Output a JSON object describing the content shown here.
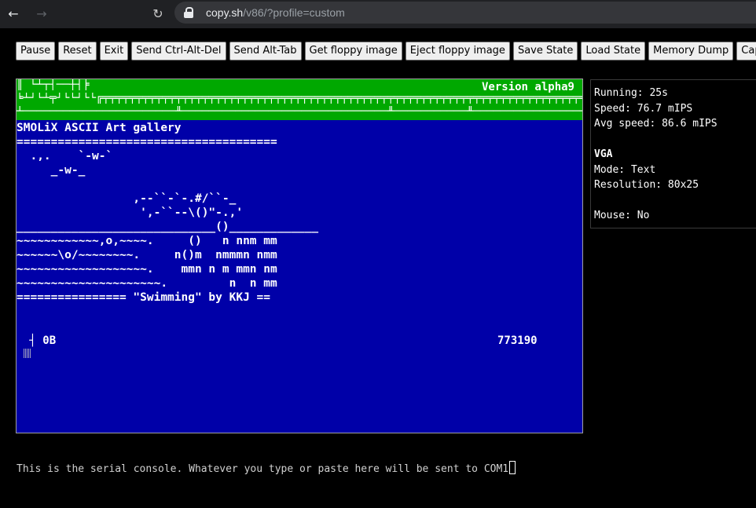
{
  "browser": {
    "back_icon": "arrow-left-icon",
    "forward_icon": "arrow-right-icon",
    "reload_icon": "reload-icon",
    "lock_icon": "lock-icon",
    "url_host": "copy.sh",
    "url_path": "/v86/?profile=custom"
  },
  "toolbar": {
    "buttons": [
      "Pause",
      "Reset",
      "Exit",
      "Send Ctrl-Alt-Del",
      "Send Alt-Tab",
      "Get floppy image",
      "Eject floppy image",
      "Save State",
      "Load State",
      "Memory Dump",
      "Captur"
    ]
  },
  "vga": {
    "banner_line1": "║ └┴┬┤──┼┤╞",
    "banner_line2": "╘┴┘└┴╤┘└└┘└└╔╤╤╤╤╤╤╤╤╤╤╤╤╤╤╤╤╤╤╤╤╤╤╤╤╤╤╤╤╤╤╤╤╤╤╤╤╤╤╤╤╤╤╤╤╤╤╤╤╤╤╤╤╤╤╤╤╤╤╤╤╤╤╤╤╤╤╤╤╤╤╤╤╤",
    "banner_line3": "┴───────────────────────╨───────────────────────────────╨───────────╨───────────────────────╨─────────────",
    "version": "Version alpha9",
    "art_lines": [
      "SMOLiX ASCII Art gallery",
      "======================================",
      "  .,.    `-w-`",
      "     _-w-_",
      "",
      "                 ,--``-`-.#/``-_",
      "                  ',-``--\\()\"-.,'",
      "_____________________________()_____________",
      "~~~~~~~~~~~~,o,~~~~.     ()   n nnm mm",
      "~~~~~~\\o/~~~~~~~~.     n()m  nmmmn nmm",
      "~~~~~~~~~~~~~~~~~~~.    mmn n m mmn nm",
      "~~~~~~~~~~~~~~~~~~~~~.         n  n mm",
      "================ \"Swimming\" by KKJ =="
    ],
    "status_line": " ┤ 0B",
    "counter": "773190"
  },
  "info": {
    "running_label": "Running:",
    "running_value": "25s",
    "speed_label": "Speed:",
    "speed_value": "76.7 mIPS",
    "avg_label": "Avg speed:",
    "avg_value": "86.6 mIPS",
    "vga_heading": "VGA",
    "mode_label": "Mode:",
    "mode_value": "Text",
    "resolution_label": "Resolution:",
    "resolution_value": "80x25",
    "mouse_label": "Mouse:",
    "mouse_value": "No"
  },
  "serial": {
    "text": "This is the serial console. Whatever you type or paste here will be sent to COM1"
  }
}
